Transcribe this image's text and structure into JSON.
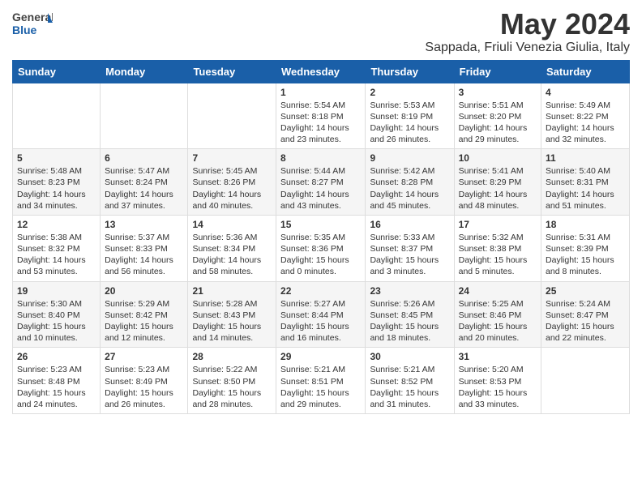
{
  "logo": {
    "text_general": "General",
    "text_blue": "Blue"
  },
  "header": {
    "month_year": "May 2024",
    "location": "Sappada, Friuli Venezia Giulia, Italy"
  },
  "weekdays": [
    "Sunday",
    "Monday",
    "Tuesday",
    "Wednesday",
    "Thursday",
    "Friday",
    "Saturday"
  ],
  "weeks": [
    [
      null,
      null,
      null,
      {
        "day": "1",
        "sunrise": "Sunrise: 5:54 AM",
        "sunset": "Sunset: 8:18 PM",
        "daylight": "Daylight: 14 hours and 23 minutes."
      },
      {
        "day": "2",
        "sunrise": "Sunrise: 5:53 AM",
        "sunset": "Sunset: 8:19 PM",
        "daylight": "Daylight: 14 hours and 26 minutes."
      },
      {
        "day": "3",
        "sunrise": "Sunrise: 5:51 AM",
        "sunset": "Sunset: 8:20 PM",
        "daylight": "Daylight: 14 hours and 29 minutes."
      },
      {
        "day": "4",
        "sunrise": "Sunrise: 5:49 AM",
        "sunset": "Sunset: 8:22 PM",
        "daylight": "Daylight: 14 hours and 32 minutes."
      }
    ],
    [
      {
        "day": "5",
        "sunrise": "Sunrise: 5:48 AM",
        "sunset": "Sunset: 8:23 PM",
        "daylight": "Daylight: 14 hours and 34 minutes."
      },
      {
        "day": "6",
        "sunrise": "Sunrise: 5:47 AM",
        "sunset": "Sunset: 8:24 PM",
        "daylight": "Daylight: 14 hours and 37 minutes."
      },
      {
        "day": "7",
        "sunrise": "Sunrise: 5:45 AM",
        "sunset": "Sunset: 8:26 PM",
        "daylight": "Daylight: 14 hours and 40 minutes."
      },
      {
        "day": "8",
        "sunrise": "Sunrise: 5:44 AM",
        "sunset": "Sunset: 8:27 PM",
        "daylight": "Daylight: 14 hours and 43 minutes."
      },
      {
        "day": "9",
        "sunrise": "Sunrise: 5:42 AM",
        "sunset": "Sunset: 8:28 PM",
        "daylight": "Daylight: 14 hours and 45 minutes."
      },
      {
        "day": "10",
        "sunrise": "Sunrise: 5:41 AM",
        "sunset": "Sunset: 8:29 PM",
        "daylight": "Daylight: 14 hours and 48 minutes."
      },
      {
        "day": "11",
        "sunrise": "Sunrise: 5:40 AM",
        "sunset": "Sunset: 8:31 PM",
        "daylight": "Daylight: 14 hours and 51 minutes."
      }
    ],
    [
      {
        "day": "12",
        "sunrise": "Sunrise: 5:38 AM",
        "sunset": "Sunset: 8:32 PM",
        "daylight": "Daylight: 14 hours and 53 minutes."
      },
      {
        "day": "13",
        "sunrise": "Sunrise: 5:37 AM",
        "sunset": "Sunset: 8:33 PM",
        "daylight": "Daylight: 14 hours and 56 minutes."
      },
      {
        "day": "14",
        "sunrise": "Sunrise: 5:36 AM",
        "sunset": "Sunset: 8:34 PM",
        "daylight": "Daylight: 14 hours and 58 minutes."
      },
      {
        "day": "15",
        "sunrise": "Sunrise: 5:35 AM",
        "sunset": "Sunset: 8:36 PM",
        "daylight": "Daylight: 15 hours and 0 minutes."
      },
      {
        "day": "16",
        "sunrise": "Sunrise: 5:33 AM",
        "sunset": "Sunset: 8:37 PM",
        "daylight": "Daylight: 15 hours and 3 minutes."
      },
      {
        "day": "17",
        "sunrise": "Sunrise: 5:32 AM",
        "sunset": "Sunset: 8:38 PM",
        "daylight": "Daylight: 15 hours and 5 minutes."
      },
      {
        "day": "18",
        "sunrise": "Sunrise: 5:31 AM",
        "sunset": "Sunset: 8:39 PM",
        "daylight": "Daylight: 15 hours and 8 minutes."
      }
    ],
    [
      {
        "day": "19",
        "sunrise": "Sunrise: 5:30 AM",
        "sunset": "Sunset: 8:40 PM",
        "daylight": "Daylight: 15 hours and 10 minutes."
      },
      {
        "day": "20",
        "sunrise": "Sunrise: 5:29 AM",
        "sunset": "Sunset: 8:42 PM",
        "daylight": "Daylight: 15 hours and 12 minutes."
      },
      {
        "day": "21",
        "sunrise": "Sunrise: 5:28 AM",
        "sunset": "Sunset: 8:43 PM",
        "daylight": "Daylight: 15 hours and 14 minutes."
      },
      {
        "day": "22",
        "sunrise": "Sunrise: 5:27 AM",
        "sunset": "Sunset: 8:44 PM",
        "daylight": "Daylight: 15 hours and 16 minutes."
      },
      {
        "day": "23",
        "sunrise": "Sunrise: 5:26 AM",
        "sunset": "Sunset: 8:45 PM",
        "daylight": "Daylight: 15 hours and 18 minutes."
      },
      {
        "day": "24",
        "sunrise": "Sunrise: 5:25 AM",
        "sunset": "Sunset: 8:46 PM",
        "daylight": "Daylight: 15 hours and 20 minutes."
      },
      {
        "day": "25",
        "sunrise": "Sunrise: 5:24 AM",
        "sunset": "Sunset: 8:47 PM",
        "daylight": "Daylight: 15 hours and 22 minutes."
      }
    ],
    [
      {
        "day": "26",
        "sunrise": "Sunrise: 5:23 AM",
        "sunset": "Sunset: 8:48 PM",
        "daylight": "Daylight: 15 hours and 24 minutes."
      },
      {
        "day": "27",
        "sunrise": "Sunrise: 5:23 AM",
        "sunset": "Sunset: 8:49 PM",
        "daylight": "Daylight: 15 hours and 26 minutes."
      },
      {
        "day": "28",
        "sunrise": "Sunrise: 5:22 AM",
        "sunset": "Sunset: 8:50 PM",
        "daylight": "Daylight: 15 hours and 28 minutes."
      },
      {
        "day": "29",
        "sunrise": "Sunrise: 5:21 AM",
        "sunset": "Sunset: 8:51 PM",
        "daylight": "Daylight: 15 hours and 29 minutes."
      },
      {
        "day": "30",
        "sunrise": "Sunrise: 5:21 AM",
        "sunset": "Sunset: 8:52 PM",
        "daylight": "Daylight: 15 hours and 31 minutes."
      },
      {
        "day": "31",
        "sunrise": "Sunrise: 5:20 AM",
        "sunset": "Sunset: 8:53 PM",
        "daylight": "Daylight: 15 hours and 33 minutes."
      },
      null
    ]
  ]
}
